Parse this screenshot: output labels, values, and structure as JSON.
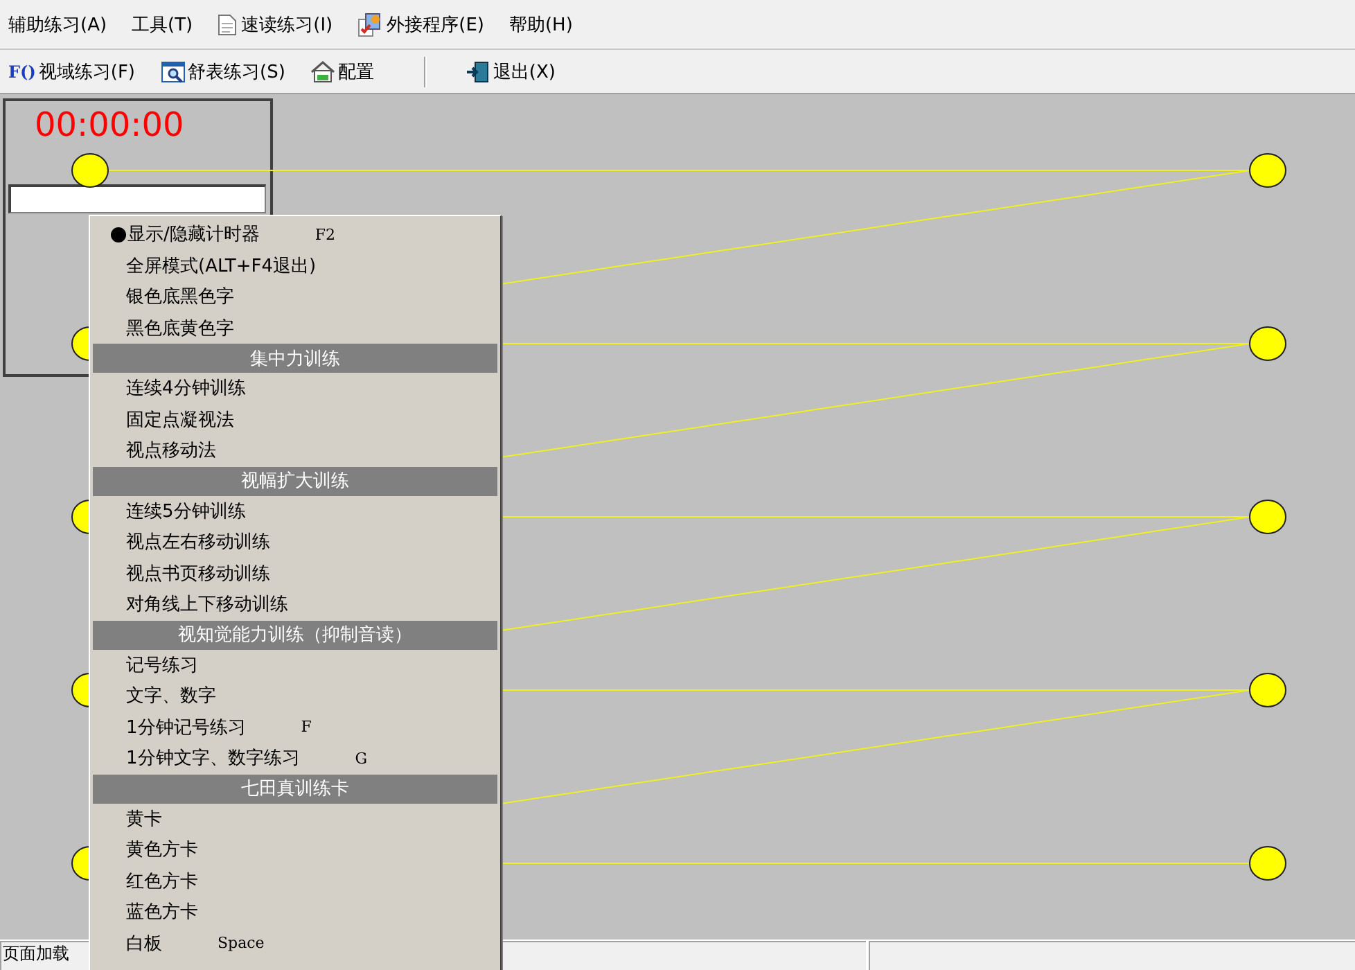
{
  "menu_bar": [
    {
      "label": "辅助练习(A)"
    },
    {
      "label": "工具(T)"
    },
    {
      "label": "速读练习(I)"
    },
    {
      "label": "外接程序(E)"
    },
    {
      "label": "帮助(H)"
    }
  ],
  "toolbar": [
    {
      "kind": "button",
      "label": "视域练习(F)",
      "badge": "F()"
    },
    {
      "kind": "button",
      "label": "舒表练习(S)"
    },
    {
      "kind": "button",
      "label": "配置"
    },
    {
      "kind": "separator"
    },
    {
      "kind": "button",
      "label": "退出(X)"
    }
  ],
  "timer": {
    "time": "00:00:00"
  },
  "context_menu": [
    {
      "kind": "item",
      "label": "显示/隐藏计时器",
      "checked": true,
      "shortcut": "F2"
    },
    {
      "kind": "item",
      "label": "全屏模式(ALT+F4退出)",
      "checked": false
    },
    {
      "kind": "item",
      "label": "银色底黑色字",
      "checked": false
    },
    {
      "kind": "item",
      "label": "黑色底黄色字",
      "checked": false
    },
    {
      "kind": "header",
      "label": "集中力训练"
    },
    {
      "kind": "item",
      "label": "连续4分钟训练",
      "checked": false
    },
    {
      "kind": "item",
      "label": "固定点凝视法",
      "checked": false
    },
    {
      "kind": "item",
      "label": "视点移动法",
      "checked": false
    },
    {
      "kind": "header",
      "label": "视幅扩大训练"
    },
    {
      "kind": "item",
      "label": "连续5分钟训练",
      "checked": false
    },
    {
      "kind": "item",
      "label": "视点左右移动训练",
      "checked": false
    },
    {
      "kind": "item",
      "label": "视点书页移动训练",
      "checked": false
    },
    {
      "kind": "item",
      "label": "对角线上下移动训练",
      "checked": false
    },
    {
      "kind": "header",
      "label": "视知觉能力训练（抑制音读）"
    },
    {
      "kind": "item",
      "label": "记号练习",
      "checked": false
    },
    {
      "kind": "item",
      "label": "文字、数字",
      "checked": false
    },
    {
      "kind": "item",
      "label": "1分钟记号练习",
      "checked": false,
      "shortcut": "F"
    },
    {
      "kind": "item",
      "label": "1分钟文字、数字练习",
      "checked": false,
      "shortcut": "G"
    },
    {
      "kind": "header",
      "label": "七田真训练卡"
    },
    {
      "kind": "item",
      "label": "黄卡",
      "checked": false
    },
    {
      "kind": "item",
      "label": "黄色方卡",
      "checked": false
    },
    {
      "kind": "item",
      "label": "红色方卡",
      "checked": false
    },
    {
      "kind": "item",
      "label": "蓝色方卡",
      "checked": false
    },
    {
      "kind": "item",
      "label": "白板",
      "checked": false,
      "shortcut": "Space"
    }
  ],
  "status_bar": {
    "text": "页面加载"
  }
}
